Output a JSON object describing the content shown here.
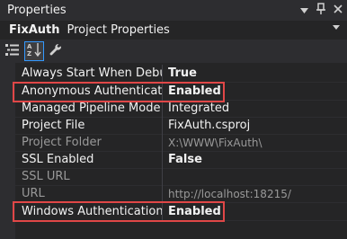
{
  "window": {
    "title": "Properties"
  },
  "selector": {
    "name": "FixAuth",
    "type": "Project Properties"
  },
  "toolbar": {
    "buttons": [
      {
        "icon": "categorized-icon"
      },
      {
        "icon": "alphabetical-icon"
      },
      {
        "icon": "property-pages-icon"
      }
    ]
  },
  "properties": [
    {
      "name": "Always Start When Debugging",
      "value": "True"
    },
    {
      "name": "Anonymous Authentication",
      "value": "Enabled"
    },
    {
      "name": "Managed Pipeline Mode",
      "value": "Integrated"
    },
    {
      "name": "Project File",
      "value": "FixAuth.csproj"
    },
    {
      "name": "Project Folder",
      "value": "X:\\WWW\\FixAuth\\"
    },
    {
      "name": "SSL Enabled",
      "value": "False"
    },
    {
      "name": "SSL URL",
      "value": ""
    },
    {
      "name": "URL",
      "value": "http://localhost:18215/"
    },
    {
      "name": "Windows Authentication",
      "value": "Enabled"
    }
  ],
  "colors": {
    "highlight": "#e04747",
    "accent": "#3399ff"
  }
}
